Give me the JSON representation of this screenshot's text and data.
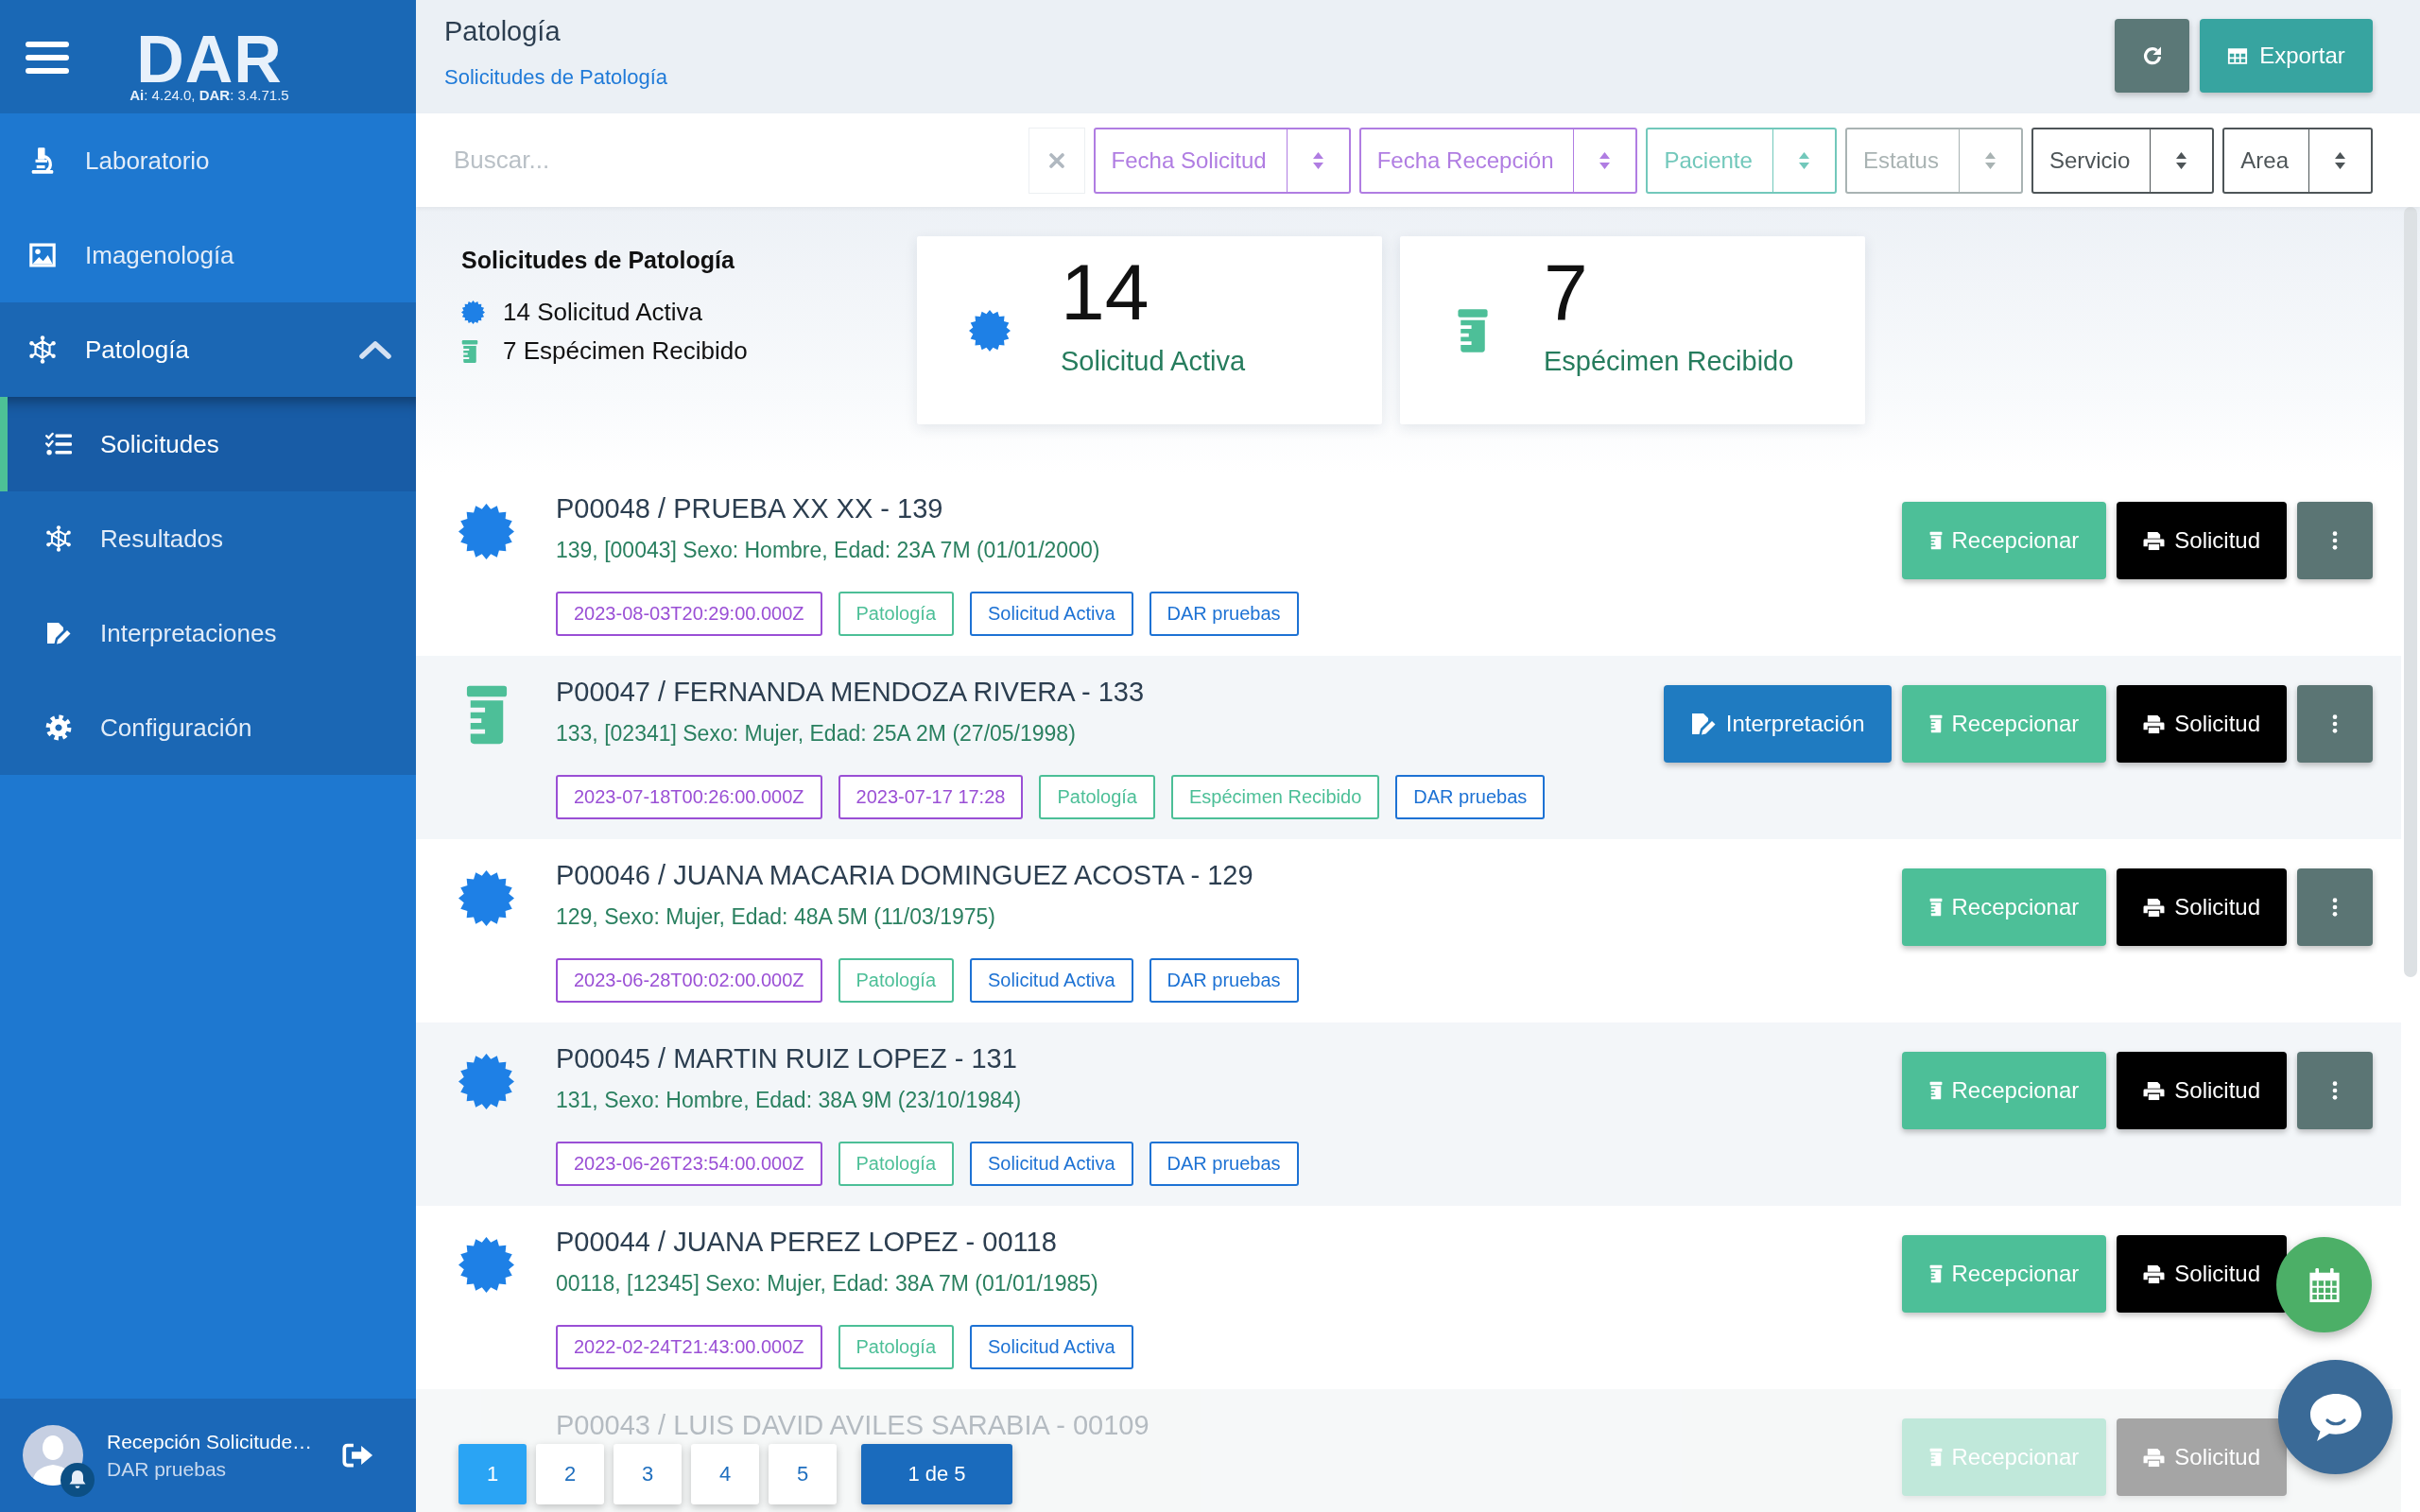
{
  "sidebar": {
    "logo": "DAR",
    "version": "**Ai**: 4.24.0, **DAR**: 3.4.71.5",
    "items": [
      {
        "label": "Laboratorio",
        "selected": false
      },
      {
        "label": "Imagenología",
        "selected": false
      },
      {
        "label": "Patología",
        "selected": false,
        "expanded": true,
        "children": [
          {
            "label": "Solicitudes",
            "selected": true
          },
          {
            "label": "Resultados",
            "selected": false
          },
          {
            "label": "Interpretaciones",
            "selected": false
          },
          {
            "label": "Configuración",
            "selected": false
          }
        ]
      }
    ],
    "user": {
      "name": "Recepción Solicitude…",
      "organization": "DAR pruebas"
    }
  },
  "header": {
    "title": "Patología",
    "breadcrumb": "Solicitudes de Patología",
    "buttons": [
      {
        "kind": "refresh"
      },
      {
        "kind": "export",
        "label": "Exportar"
      }
    ]
  },
  "filter_bar": {
    "search": {
      "placeholder": "Buscar..."
    },
    "filters": [
      {
        "label": "Fecha Solicitud",
        "color": "#b07de2"
      },
      {
        "label": "Fecha Recepción",
        "color": "#b07de2"
      },
      {
        "label": "Paciente",
        "color": "#72c8bb"
      },
      {
        "label": "Estatus",
        "color": "#a9b3b3"
      },
      {
        "label": "Servicio",
        "color": "#4e5558"
      },
      {
        "label": "Area",
        "color": "#4e5558"
      }
    ]
  },
  "summary": {
    "title": "Solicitudes de Patología",
    "legend": [
      {
        "kind": "active",
        "text": "14 Solicitud Activa"
      },
      {
        "kind": "received",
        "text": "7 Espécimen Recibido"
      }
    ],
    "cards": [
      {
        "kind": "active",
        "value": "14",
        "label": "Solicitud Activa"
      },
      {
        "kind": "received",
        "value": "7",
        "label": "Espécimen Recibido"
      }
    ]
  },
  "requests": [
    {
      "kind": "active",
      "title": "P00048 / PRUEBA XX XX - 139",
      "details": "139, [00043] Sexo: Hombre, Edad: 23A 7M (01/01/2000)",
      "tags": [
        {
          "text": "2023-08-03T20:29:00.000Z",
          "color": "#9a4fd5"
        },
        {
          "text": "Patología",
          "color": "#4cbf97"
        },
        {
          "text": "Solicitud Activa",
          "color": "#1d72d4"
        },
        {
          "text": "DAR pruebas",
          "color": "#1d72d4"
        }
      ],
      "actions": [
        {
          "kind": "receive",
          "label": "Recepcionar"
        },
        {
          "kind": "print",
          "label": "Solicitud"
        },
        {
          "kind": "more"
        }
      ]
    },
    {
      "kind": "received",
      "title": "P00047 / FERNANDA MENDOZA RIVERA - 133",
      "details": "133, [02341] Sexo: Mujer, Edad: 25A 2M (27/05/1998)",
      "tags": [
        {
          "text": "2023-07-18T00:26:00.000Z",
          "color": "#9a4fd5"
        },
        {
          "text": "2023-07-17 17:28",
          "color": "#9a4fd5"
        },
        {
          "text": "Patología",
          "color": "#4cbf97"
        },
        {
          "text": "Espécimen Recibido",
          "color": "#4cbf97"
        },
        {
          "text": "DAR pruebas",
          "color": "#1d72d4"
        }
      ],
      "actions": [
        {
          "kind": "interpretation",
          "label": "Interpretación"
        },
        {
          "kind": "receive",
          "label": "Recepcionar"
        },
        {
          "kind": "print",
          "label": "Solicitud"
        },
        {
          "kind": "more"
        }
      ]
    },
    {
      "kind": "active",
      "title": "P00046 / JUANA MACARIA DOMINGUEZ ACOSTA - 129",
      "details": "129, Sexo: Mujer, Edad: 48A 5M (11/03/1975)",
      "tags": [
        {
          "text": "2023-06-28T00:02:00.000Z",
          "color": "#9a4fd5"
        },
        {
          "text": "Patología",
          "color": "#4cbf97"
        },
        {
          "text": "Solicitud Activa",
          "color": "#1d72d4"
        },
        {
          "text": "DAR pruebas",
          "color": "#1d72d4"
        }
      ],
      "actions": [
        {
          "kind": "receive",
          "label": "Recepcionar"
        },
        {
          "kind": "print",
          "label": "Solicitud"
        },
        {
          "kind": "more"
        }
      ]
    },
    {
      "kind": "active",
      "title": "P00045 / MARTIN RUIZ LOPEZ - 131",
      "details": "131, Sexo: Hombre, Edad: 38A 9M (23/10/1984)",
      "tags": [
        {
          "text": "2023-06-26T23:54:00.000Z",
          "color": "#9a4fd5"
        },
        {
          "text": "Patología",
          "color": "#4cbf97"
        },
        {
          "text": "Solicitud Activa",
          "color": "#1d72d4"
        },
        {
          "text": "DAR pruebas",
          "color": "#1d72d4"
        }
      ],
      "actions": [
        {
          "kind": "receive",
          "label": "Recepcionar"
        },
        {
          "kind": "print",
          "label": "Solicitud"
        },
        {
          "kind": "more"
        }
      ]
    },
    {
      "kind": "active",
      "title": "P00044 / JUANA PEREZ LOPEZ - 00118",
      "details": "00118, [12345] Sexo: Mujer, Edad: 38A 7M (01/01/1985)",
      "tags": [
        {
          "text": "2022-02-24T21:43:00.000Z",
          "color": "#9a4fd5"
        },
        {
          "text": "Patología",
          "color": "#4cbf97"
        },
        {
          "text": "Solicitud Activa",
          "color": "#1d72d4"
        }
      ],
      "actions": [
        {
          "kind": "receive",
          "label": "Recepcionar"
        },
        {
          "kind": "print",
          "label": "Solicitud"
        }
      ]
    },
    {
      "title": "P00043 / LUIS DAVID AVILES SARABIA - 00109",
      "actions": [
        {
          "kind": "receive",
          "label": "Recepcionar"
        },
        {
          "kind": "print",
          "label": "Solicitud"
        }
      ]
    }
  ],
  "pagination": {
    "pages": [
      {
        "label": "1",
        "selected": true
      },
      {
        "label": "2",
        "selected": false
      },
      {
        "label": "3",
        "selected": false
      },
      {
        "label": "4",
        "selected": false
      },
      {
        "label": "5",
        "selected": false
      }
    ],
    "summary": "1 de 5"
  }
}
